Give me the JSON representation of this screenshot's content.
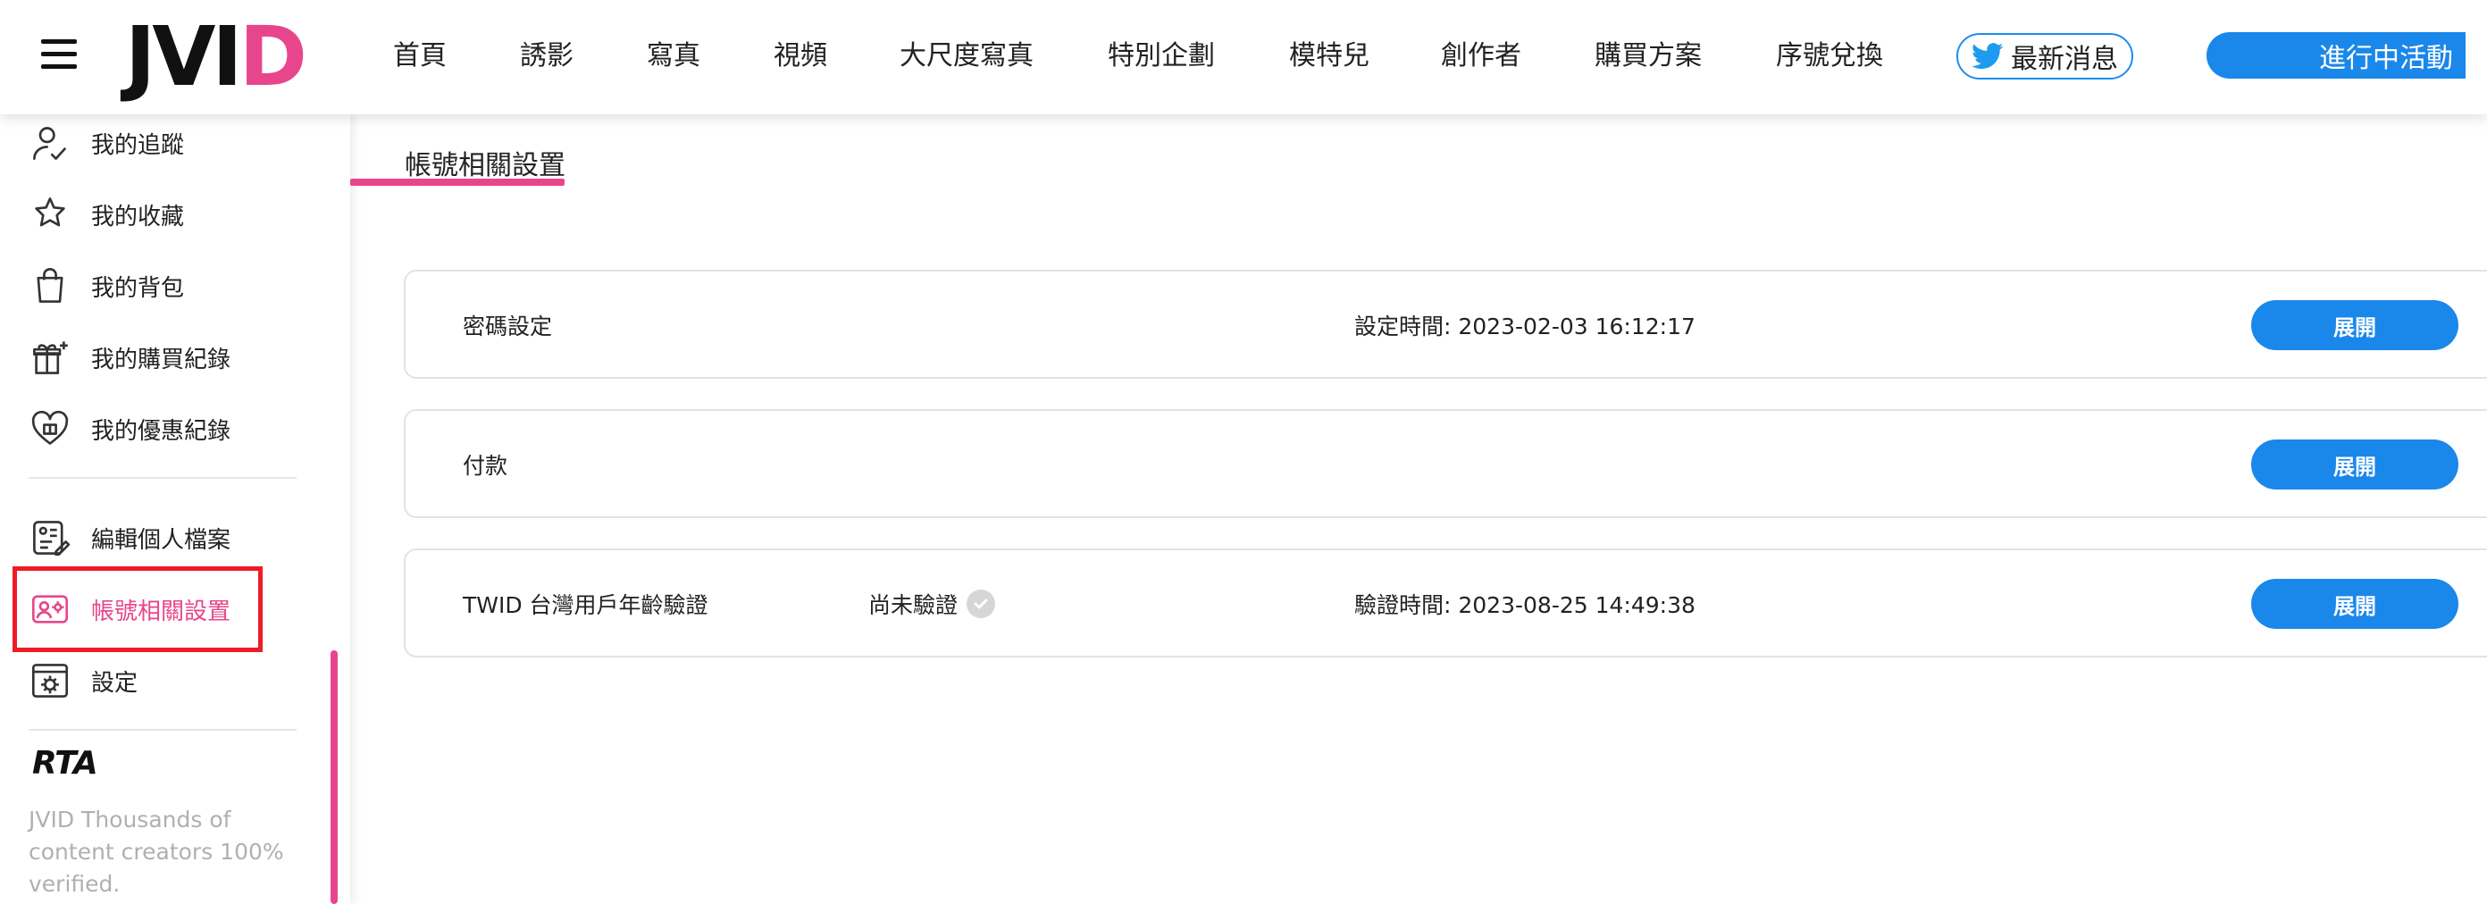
{
  "header": {
    "logo_black": "JVI",
    "logo_pink": "D",
    "nav": [
      "首頁",
      "誘影",
      "寫真",
      "視頻",
      "大尺度寫真",
      "特別企劃",
      "模特兒",
      "創作者",
      "購買方案",
      "序號兌換"
    ],
    "twitter_label": "最新消息",
    "activity_label": "進行中活動"
  },
  "sidebar": {
    "items": [
      {
        "label": "我的追蹤",
        "icon": "user-check-icon"
      },
      {
        "label": "我的收藏",
        "icon": "star-outline-icon"
      },
      {
        "label": "我的背包",
        "icon": "shopping-bag-icon"
      },
      {
        "label": "我的購買紀錄",
        "icon": "gift-icon"
      },
      {
        "label": "我的優惠紀錄",
        "icon": "heart-gift-icon"
      },
      {
        "label": "編輯個人檔案",
        "icon": "profile-card-edit-icon"
      },
      {
        "label": "帳號相關設置",
        "icon": "account-settings-icon",
        "active": true
      },
      {
        "label": "設定",
        "icon": "settings-window-icon"
      }
    ],
    "rta_logo": "RTA",
    "rta_text": "JVID Thousands of content creators 100% verified."
  },
  "main": {
    "page_title": "帳號相關設置",
    "cards": [
      {
        "label": "密碼設定",
        "middle": "",
        "time": "設定時間: 2023-02-03 16:12:17",
        "button": "展開"
      },
      {
        "label": "付款",
        "middle": "",
        "time": "",
        "button": "展開"
      },
      {
        "label": "TWID 台灣用戶年齡驗證",
        "middle": "尚未驗證",
        "time": "驗證時間: 2023-08-25 14:49:38",
        "button": "展開"
      }
    ]
  },
  "colors": {
    "accent_pink": "#e8468c",
    "accent_blue": "#1a87ea",
    "highlight_red": "#ee1c25"
  }
}
